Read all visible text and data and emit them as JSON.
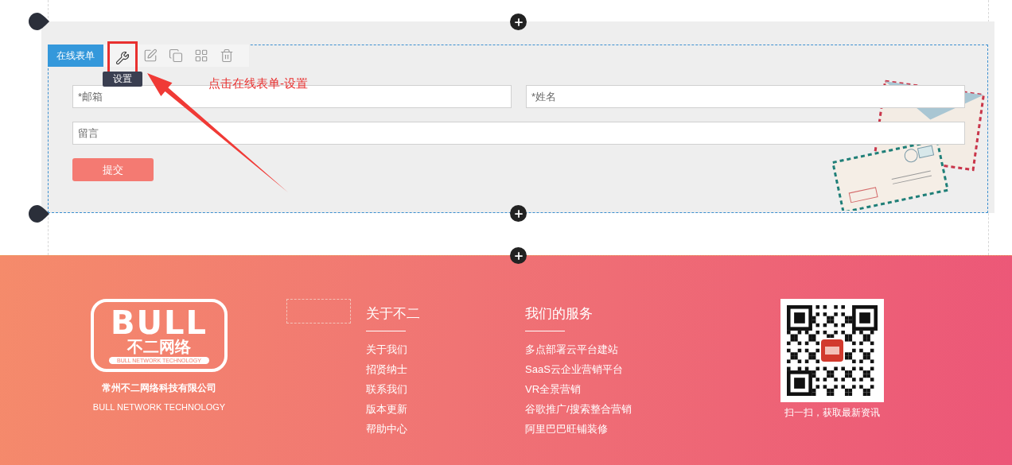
{
  "editor": {
    "module_label": "在线表单",
    "tools": [
      {
        "kind": "settings",
        "highlighted": true
      },
      {
        "kind": "edit",
        "highlighted": false
      },
      {
        "kind": "copy",
        "highlighted": false
      },
      {
        "kind": "layout",
        "highlighted": false
      },
      {
        "kind": "delete",
        "highlighted": false
      }
    ],
    "tooltip": "设置",
    "annotation": "点击在线表单-设置"
  },
  "form": {
    "fields": [
      {
        "placeholder": "*邮箱",
        "kind": "half"
      },
      {
        "placeholder": "*姓名",
        "kind": "half"
      },
      {
        "placeholder": "留言",
        "kind": "full"
      }
    ],
    "submit": "提交"
  },
  "footer": {
    "logo": {
      "wordmark": "BULL",
      "chinese": "不二网络",
      "tagline": "BULL NETWORK TECHNOLOGY"
    },
    "company": "常州不二网络科技有限公司",
    "company_en": "BULL NETWORK TECHNOLOGY",
    "columns": [
      {
        "title": "关于不二",
        "links": [
          "关于我们",
          "招贤纳士",
          "联系我们",
          "版本更新",
          "帮助中心"
        ]
      },
      {
        "title": "我们的服务",
        "links": [
          "多点部署云平台建站",
          "SaaS云企业营销平台",
          "VR全景营销",
          "谷歌推广/搜索整合营销",
          "阿里巴巴旺铺装修"
        ]
      }
    ],
    "qr_caption": "扫一扫，获取最新资讯"
  }
}
